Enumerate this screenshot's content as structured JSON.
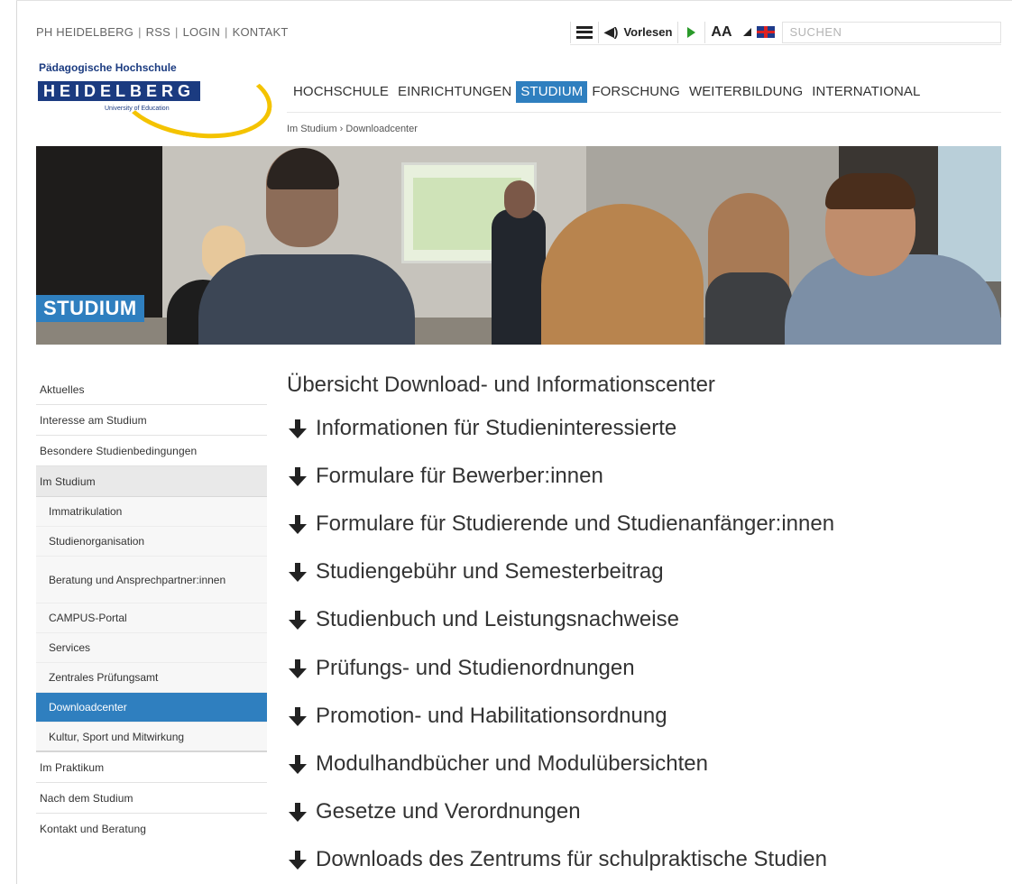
{
  "toplinks": [
    "PH HEIDELBERG",
    "RSS",
    "LOGIN",
    "KONTAKT"
  ],
  "tools": {
    "read_aloud": "Vorlesen",
    "font_size": "AA",
    "search_placeholder": "SUCHEN"
  },
  "logo": {
    "line1": "Pädagogische Hochschule",
    "line2": "HEIDELBERG",
    "line3": "University of Education"
  },
  "mainnav": [
    "HOCHSCHULE",
    "EINRICHTUNGEN",
    "STUDIUM",
    "FORSCHUNG",
    "WEITERBILDUNG",
    "INTERNATIONAL"
  ],
  "breadcrumb": "Im Studium › Downloadcenter",
  "hero": {
    "label": "STUDIUM"
  },
  "sidebar": {
    "items": [
      "Aktuelles",
      "Interesse am Studium",
      "Besondere Studienbedingungen",
      "Im Studium"
    ],
    "subitems": [
      "Immatrikulation",
      "Studienorganisation",
      "Beratung und Ansprechpartner:innen",
      "CAMPUS-Portal",
      "Services",
      "Zentrales Prüfungsamt",
      "Downloadcenter",
      "Kultur, Sport und Mitwirkung"
    ],
    "after": [
      "Im Praktikum",
      "Nach dem Studium",
      "Kontakt und Beratung"
    ]
  },
  "content": {
    "title": "Übersicht Download- und Informationscenter",
    "items": [
      "Informationen für Studieninteressierte",
      "Formulare für Bewerber:innen",
      "Formulare für Studierende und Studienanfänger:innen",
      "Studiengebühr und Semesterbeitrag",
      "Studienbuch und Leistungsnachweise",
      "Prüfungs- und Studienordnungen",
      "Promotion- und Habilitationsordnung",
      "Modulhandbücher und Modulübersichten",
      "Gesetze und Verordnungen",
      "Downloads des Zentrums für schulpraktische Studien"
    ]
  }
}
